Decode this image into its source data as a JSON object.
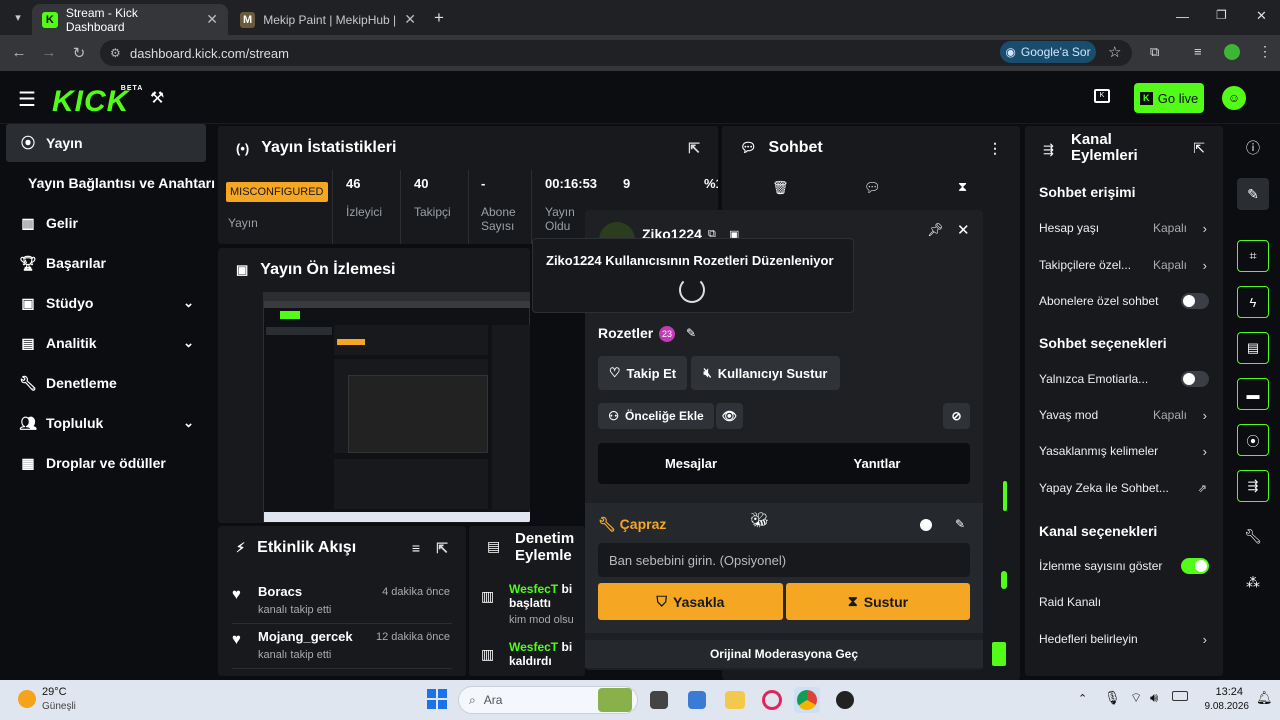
{
  "browser": {
    "tabs": [
      {
        "title": "Stream - Kick Dashboard",
        "active": true
      },
      {
        "title": "Mekip Paint | MekipHub | Meki",
        "active": false
      }
    ],
    "url": "dashboard.kick.com/stream",
    "ask_google": "Google'a Sor"
  },
  "header": {
    "logo": "KICK",
    "logo_badge": "BETA",
    "go_live": "Go live",
    "accent": "#53fc18"
  },
  "sidebar": {
    "items": [
      {
        "label": "Yayın",
        "icon": "broadcast-icon"
      },
      {
        "label": "Yayın Bağlantısı ve Anahtarı",
        "icon": ""
      },
      {
        "label": "Gelir",
        "icon": "revenue-icon"
      },
      {
        "label": "Başarılar",
        "icon": "trophy-icon"
      },
      {
        "label": "Stüdyo",
        "icon": "studio-icon"
      },
      {
        "label": "Analitik",
        "icon": "analytics-icon"
      },
      {
        "label": "Denetleme",
        "icon": "wrench-icon"
      },
      {
        "label": "Topluluk",
        "icon": "community-icon"
      },
      {
        "label": "Droplar ve ödüller",
        "icon": "drops-icon"
      }
    ]
  },
  "stats": {
    "title": "Yayın İstatistikleri",
    "status_badge": "MISCONFIGURED",
    "status_label": "Yayın",
    "viewers": {
      "value": "46",
      "label": "İzleyici"
    },
    "followers": {
      "value": "40",
      "label": "Takipçi"
    },
    "subs": {
      "value": "-",
      "label": "Abone Sayısı"
    },
    "uptime": {
      "value": "00:16:53",
      "label": "Yayın Oldu"
    },
    "extra1": {
      "value": "9"
    },
    "extra2": {
      "value": "%1"
    }
  },
  "preview": {
    "title": "Yayın Ön İzlemesi"
  },
  "activity": {
    "title": "Etkinlik Akışı",
    "items": [
      {
        "name": "Boracs",
        "sub": "kanalı takip etti",
        "time": "4 dakika önce"
      },
      {
        "name": "Mojang_gercek",
        "sub": "kanalı takip etti",
        "time": "12 dakika önce"
      }
    ]
  },
  "mod_actions": {
    "title": "Denetim Eylemle",
    "items": [
      {
        "name": "WesfecT",
        "suffix": "bi",
        "line2": "başlattı",
        "line3": "kim mod olsu"
      },
      {
        "name": "WesfecT",
        "suffix": "bi",
        "line2": "kaldırdı",
        "line3": ""
      }
    ]
  },
  "chat": {
    "title": "Sohbet"
  },
  "user_modal": {
    "username": "Ziko1224",
    "badge_popup": "Ziko1224 Kullanıcısının Rozetleri Düzenleniyor",
    "badges_label": "Rozetler",
    "badges_count": "23",
    "follow": "Takip Et",
    "mute_user": "Kullanıcıyı Sustur",
    "add_priority": "Önceliğe Ekle",
    "tabs": [
      "Mesajlar",
      "Yanıtlar"
    ],
    "mod_label": "Çapraz",
    "ban_reason_placeholder": "Ban sebebini girin. (Opsiyonel)",
    "ban": "Yasakla",
    "mute": "Sustur",
    "original_mod": "Orijinal Moderasyona Geç"
  },
  "channel_actions": {
    "title_line1": "Kanal",
    "title_line2": "Eylemleri",
    "chat_access": "Sohbet erişimi",
    "account_age": {
      "label": "Hesap yaşı",
      "value": "Kapalı"
    },
    "followers_only": {
      "label": "Takipçilere özel...",
      "value": "Kapalı"
    },
    "subs_only": {
      "label": "Abonelere özel sohbet",
      "on": false
    },
    "chat_options": "Sohbet seçenekleri",
    "emote_only": {
      "label": "Yalnızca Emotiarla...",
      "on": false
    },
    "slow_mode": {
      "label": "Yavaş mod",
      "value": "Kapalı"
    },
    "banned_words": {
      "label": "Yasaklanmış kelimeler"
    },
    "ai_chat": {
      "label": "Yapay Zeka ile Sohbet..."
    },
    "channel_options": "Kanal seçenekleri",
    "show_viewers": {
      "label": "İzlenme sayısını göster",
      "on": true
    },
    "raid": {
      "label": "Raid Kanalı"
    },
    "goals": {
      "label": "Hedefleri belirleyin"
    }
  },
  "taskbar": {
    "weather_temp": "29°C",
    "weather_desc": "Güneşli",
    "search": "Ara",
    "time": "13:24",
    "date": "9.08.2026"
  }
}
